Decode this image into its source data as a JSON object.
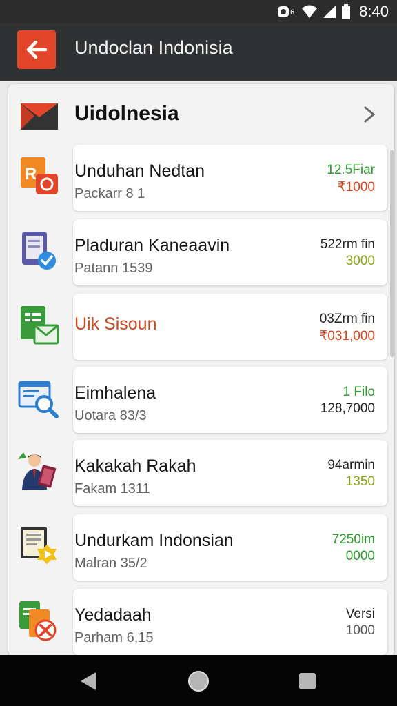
{
  "status_bar": {
    "time": "8:40"
  },
  "app_bar": {
    "title": "Undoclan Indonisia"
  },
  "panel": {
    "title": "Uidolnesia"
  },
  "items": [
    {
      "title": "Unduhan Nedtan",
      "subtitle": "Packarr 8 1",
      "meta1": "12.5Fiar",
      "meta2": "₹1000",
      "meta1_color": "#2e9a2e",
      "meta2_color": "#d2461f",
      "title_color": "#151515",
      "icon": "image-document-icon"
    },
    {
      "title": "Pladuran Kaneaavin",
      "subtitle": "Patann 1539",
      "meta1": "522rm fin",
      "meta2": "3000",
      "meta1_color": "#222222",
      "meta2_color": "#8da11a",
      "title_color": "#151515",
      "icon": "tablet-check-icon"
    },
    {
      "title": "Uik Sisoun",
      "subtitle": "",
      "meta1": "03Zrm fin",
      "meta2": "₹031,000",
      "meta1_color": "#222222",
      "meta2_color": "#d2461f",
      "title_color": "#c84a22",
      "icon": "spreadsheet-mail-icon"
    },
    {
      "title": "Eimhalena",
      "subtitle": "Uotara 83/3",
      "meta1": "1 Filo",
      "meta2": "128,7000",
      "meta1_color": "#2e9a2e",
      "meta2_color": "#222222",
      "title_color": "#151515",
      "icon": "document-search-icon"
    },
    {
      "title": "Kakakah Rakah",
      "subtitle": "Fakam 1311",
      "meta1": "94armin",
      "meta2": "1350",
      "meta1_color": "#222222",
      "meta2_color": "#8da11a",
      "title_color": "#151515",
      "icon": "businessman-icon"
    },
    {
      "title": "Undurkam Indonsian",
      "subtitle": "Malran 35/2",
      "meta1": "7250im",
      "meta2": "0000",
      "meta1_color": "#2e9a2e",
      "meta2_color": "#2e9a2e",
      "title_color": "#151515",
      "icon": "document-play-icon"
    },
    {
      "title": "Yedadaah",
      "subtitle": "Parham 6,15",
      "meta1": "Versi",
      "meta2": "1000",
      "meta1_color": "#222222",
      "meta2_color": "#555555",
      "title_color": "#151515",
      "icon": "files-badge-icon"
    }
  ],
  "colors": {
    "accent": "#e1462a",
    "appbar": "#2f3133",
    "navbar": "#050505"
  }
}
